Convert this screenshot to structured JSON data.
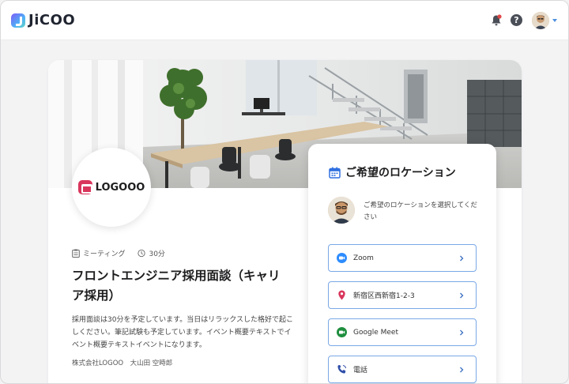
{
  "header": {
    "brand": "JiCOO",
    "help_glyph": "?",
    "icons": [
      "bell-icon",
      "help-icon",
      "user-avatar",
      "caret-down-icon"
    ]
  },
  "event": {
    "logo_text": "LOGOOO",
    "type_label": "ミーティング",
    "duration_label": "30分",
    "title": "フロントエンジニア採用面談（キャリア採用）",
    "description": "採用面談は30分を予定しています。当日はリラックスした格好で起こしください。筆記試験も予定しています。イベント概要テキストでイベント概要テキストイベントになります。",
    "organizer": "株式会社LOGOO　大山田 空時郎"
  },
  "location_panel": {
    "title": "ご希望のロケーション",
    "host_message": "ご希望のロケーションを選択してください",
    "options": [
      {
        "label": "Zoom",
        "icon": "zoom-icon",
        "color": "#2d8cff"
      },
      {
        "label": "新宿区西新宿1-2-3",
        "icon": "map-pin-icon",
        "color": "#d9365c"
      },
      {
        "label": "Google Meet",
        "icon": "google-meet-icon",
        "color": "#1e8e3e"
      },
      {
        "label": "電話",
        "icon": "phone-icon",
        "color": "#2f4fa8"
      }
    ]
  },
  "colors": {
    "accent": "#4a8fe0",
    "option_border": "#7aa8e6",
    "logo_red": "#d9365c",
    "calendar_blue": "#2f6fe0"
  }
}
